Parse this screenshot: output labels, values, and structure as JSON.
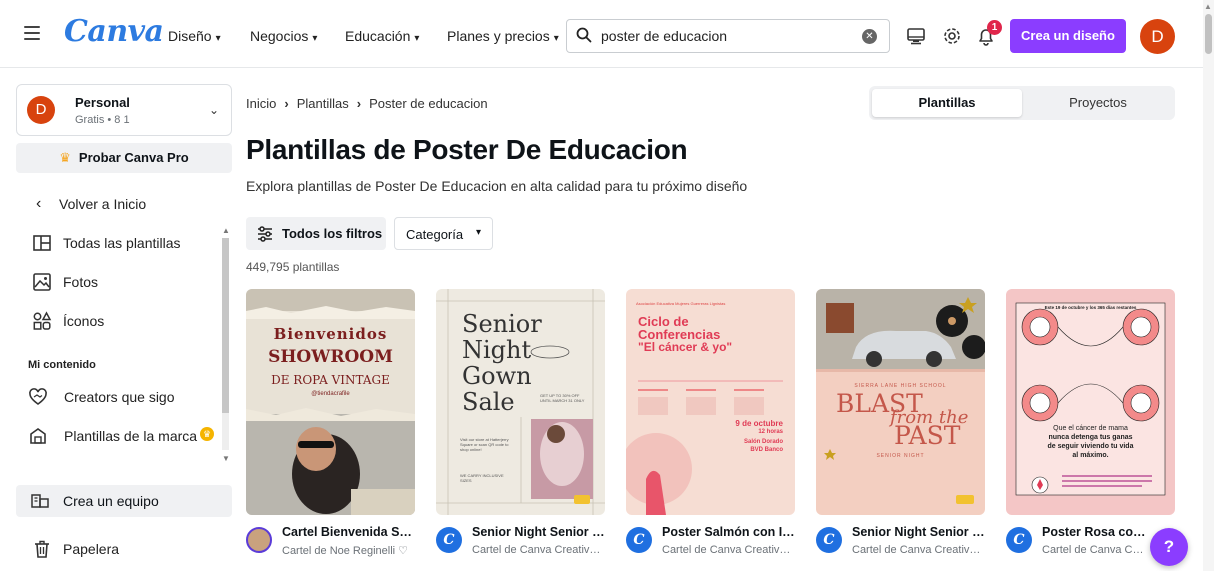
{
  "topbar": {
    "logo": "Canva",
    "nav": [
      {
        "label": "Diseño"
      },
      {
        "label": "Negocios"
      },
      {
        "label": "Educación"
      },
      {
        "label": "Planes y precios"
      }
    ],
    "search": {
      "value": "poster de educacion"
    },
    "notification_count": "1",
    "cta_label": "Crea un diseño",
    "avatar_initial": "D"
  },
  "sidebar": {
    "account": {
      "initial": "D",
      "name": "Personal",
      "plan": "Gratis • 8 1"
    },
    "pro_label": "Probar Canva Pro",
    "back_label": "Volver a Inicio",
    "items": [
      {
        "label": "Todas las plantillas",
        "icon": "templates-icon"
      },
      {
        "label": "Fotos",
        "icon": "photos-icon"
      },
      {
        "label": "Íconos",
        "icon": "shapes-icon"
      }
    ],
    "section_title": "Mi contenido",
    "content_items": [
      {
        "label": "Creators que sigo",
        "icon": "heart-icon"
      },
      {
        "label": "Plantillas de la marca",
        "icon": "brand-icon"
      }
    ],
    "team_label": "Crea un equipo",
    "trash_label": "Papelera"
  },
  "breadcrumb": [
    "Inicio",
    "Plantillas",
    "Poster de educacion"
  ],
  "toggle": {
    "active": "Plantillas",
    "inactive": "Proyectos"
  },
  "page_title": "Plantillas de Poster De Educacion",
  "subtitle": "Explora plantillas de Poster De Educacion en alta calidad para tu próximo diseño",
  "filters": {
    "all_label": "Todos los filtros",
    "category_label": "Categoría"
  },
  "result_count": "449,795 plantillas",
  "cards": [
    {
      "title": "Cartel Bienvenida Showroom",
      "author": "Cartel de Noe Reginelli ♡",
      "thumb": {
        "l1": "Bienvenidos",
        "l2": "SHOWROOM",
        "l3": "DE ROPA VINTAGE",
        "l4": "@tiendacrafile"
      }
    },
    {
      "title": "Senior Night Senior Gown Sale",
      "author": "Cartel de Canva Creative Studio",
      "thumb": {
        "l1": "Senior",
        "l2": "Night",
        "l3": "Gown",
        "l4": "Sale",
        "l5": "GET UP TO 30% OFF UNTIL MARCH 31 ONLY",
        "l6": "Visit our store at Hatterjerry Square or scan QR code to shop online!",
        "l7": "WE CARRY INCLUSIVE SIZES"
      }
    },
    {
      "title": "Poster Salmón con Ilustración",
      "author": "Cartel de Canva Creative Studio",
      "thumb": {
        "l0": "Asociación Educativa Mujeres Guerreras Lignistas",
        "l1": "Ciclo de",
        "l2": "Conferencias",
        "l3": "\"El cáncer & yo\"",
        "l4": "9 de octubre",
        "l5": "12 horas",
        "l6": "Salón Dorado",
        "l7": "BVD Banco"
      }
    },
    {
      "title": "Senior Night Senior Blast from the Past",
      "author": "Cartel de Canva Creative Studio",
      "thumb": {
        "l1": "SIERRA LANE HIGH SCHOOL",
        "l2": "BLAST",
        "l3": "from the",
        "l4": "PAST",
        "l5": "SENIOR NIGHT"
      }
    },
    {
      "title": "Poster Rosa con Ilustraciones",
      "author": "Cartel de Canva Creative Studio",
      "thumb": {
        "l1": "Este 19 de octubre y los 365 días restantes",
        "l2": "Que el cáncer de mama",
        "l3": "nunca detenga tus ganas",
        "l4": "de seguir viviendo tu vida",
        "l5": "al máximo."
      }
    }
  ],
  "help_label": "?"
}
